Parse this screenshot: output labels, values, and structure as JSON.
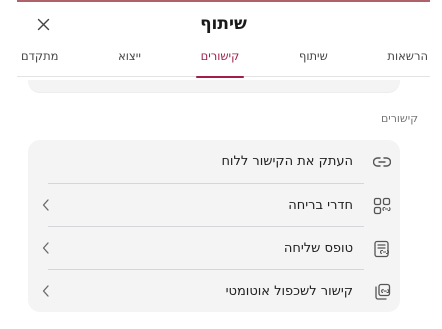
{
  "dialog": {
    "title": "שיתוף"
  },
  "tabs": [
    {
      "label": "הרשאות",
      "active": false
    },
    {
      "label": "שיתוף",
      "active": false
    },
    {
      "label": "קישורים",
      "active": true
    },
    {
      "label": "ייצוא",
      "active": false
    },
    {
      "label": "מתקדם",
      "active": false
    }
  ],
  "section": {
    "label": "קישורים"
  },
  "link_rows": [
    {
      "label": "העתק את הקישור ללוח",
      "icon": "link-icon",
      "has_chevron": false
    },
    {
      "label": "חדרי בריחה",
      "icon": "grid-link-icon",
      "has_chevron": true
    },
    {
      "label": "טופס שליחה",
      "icon": "form-link-icon",
      "has_chevron": true
    },
    {
      "label": "קישור לשכפול אוטומטי",
      "icon": "duplicate-link-icon",
      "has_chevron": true
    }
  ],
  "colors": {
    "accent": "#a21d4a",
    "card_bg": "#f4f4f5",
    "top_border": "#b0626a"
  }
}
